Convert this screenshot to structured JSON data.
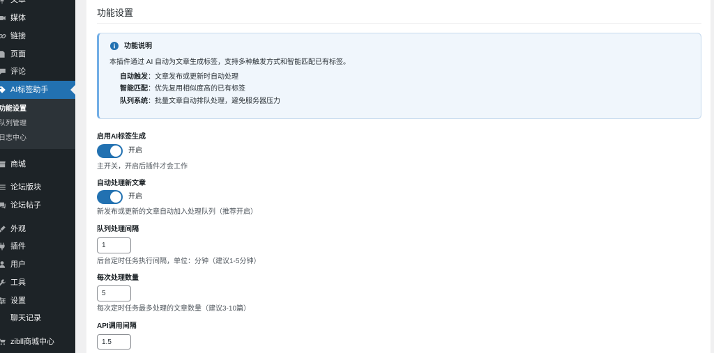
{
  "sidebar": {
    "menu": [
      {
        "label": "文章",
        "icon": "pin-icon"
      },
      {
        "label": "媒体",
        "icon": "media-icon"
      },
      {
        "label": "链接",
        "icon": "link-icon"
      },
      {
        "label": "页面",
        "icon": "page-icon"
      },
      {
        "label": "评论",
        "icon": "comment-icon"
      },
      {
        "label": "AI标签助手",
        "icon": "tag-icon",
        "active": true
      }
    ],
    "submenu": [
      {
        "label": "功能设置",
        "current": true
      },
      {
        "label": "队列管理"
      },
      {
        "label": "日志中心"
      }
    ],
    "menu2": [
      {
        "label": "商城",
        "icon": "store-icon"
      },
      {
        "label": "论坛版块",
        "icon": "forum-icon"
      },
      {
        "label": "论坛帖子",
        "icon": "forum-icon"
      },
      {
        "label": "外观",
        "icon": "brush-icon"
      },
      {
        "label": "插件",
        "icon": "plugin-icon"
      },
      {
        "label": "用户",
        "icon": "user-icon"
      },
      {
        "label": "工具",
        "icon": "wrench-icon"
      },
      {
        "label": "设置",
        "icon": "settings-icon"
      },
      {
        "label": "聊天记录"
      },
      {
        "label": "zibll商城中心",
        "icon": "cart-icon"
      }
    ]
  },
  "page": {
    "title": "功能设置"
  },
  "notice": {
    "icon": "info-icon",
    "title": "功能说明",
    "description": "本插件通过 AI 自动为文章生成标签，支持多种触发方式和智能匹配已有标签。",
    "features": [
      {
        "name": "自动触发",
        "text": "：文章发布或更新时自动处理"
      },
      {
        "name": "智能匹配",
        "text": "：优先复用相似度高的已有标签"
      },
      {
        "name": "队列系统",
        "text": "：批量文章自动排队处理，避免服务器压力"
      }
    ]
  },
  "settings": {
    "enable_ai_tags": {
      "label": "启用AI标签生成",
      "enabled": true,
      "toggle_text": "开启",
      "description": "主开关，开启后插件才会工作"
    },
    "auto_process_new": {
      "label": "自动处理新文章",
      "enabled": true,
      "toggle_text": "开启",
      "description": "新发布或更新的文章自动加入处理队列（推荐开启）"
    },
    "queue_interval": {
      "label": "队列处理间隔",
      "value": "1",
      "description": "后台定时任务执行间隔，单位：分钟（建议1-5分钟）"
    },
    "batch_size": {
      "label": "每次处理数量",
      "value": "5",
      "description": "每次定时任务最多处理的文章数量（建议3-10篇）"
    },
    "api_interval": {
      "label": "API调用间隔",
      "value": "1.5"
    }
  },
  "colors": {
    "accent": "#2271b1",
    "sidebar_bg": "#1d2327",
    "submenu_bg": "#2c3338",
    "notice_bg": "#f0f6fc",
    "notice_border": "#72aee6",
    "page_bg": "#f0f0f1"
  }
}
